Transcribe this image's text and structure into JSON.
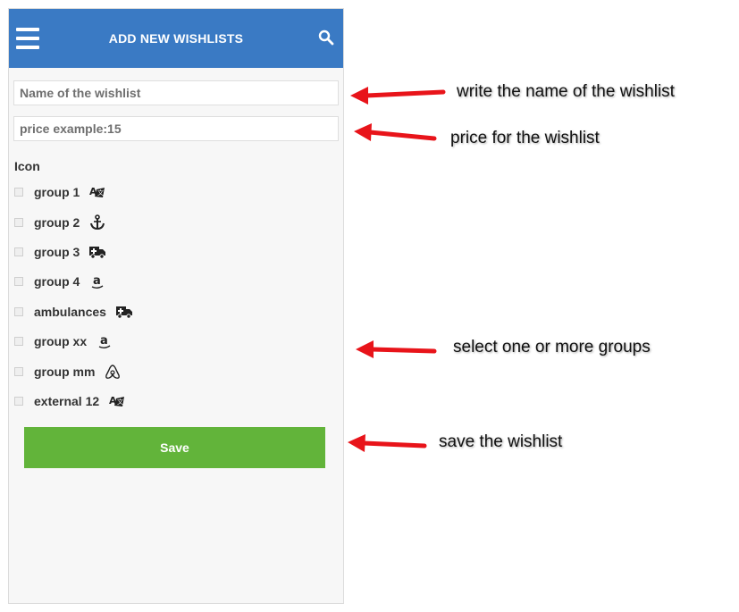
{
  "header": {
    "title": "ADD NEW WISHLISTS",
    "menu_icon": "hamburger-icon",
    "search_icon": "search-icon"
  },
  "form": {
    "name_placeholder": "Name of the wishlist",
    "price_placeholder": "price example:15",
    "icon_label": "Icon",
    "groups": [
      {
        "label": "group 1",
        "icon": "translate-icon"
      },
      {
        "label": "group 2",
        "icon": "anchor-icon"
      },
      {
        "label": "group 3",
        "icon": "ambulance-icon"
      },
      {
        "label": "group 4",
        "icon": "amazon-icon"
      },
      {
        "label": "ambulances",
        "icon": "ambulance-icon"
      },
      {
        "label": "group xx",
        "icon": "amazon-icon"
      },
      {
        "label": "group mm",
        "icon": "airbnb-icon"
      },
      {
        "label": "external 12",
        "icon": "translate-icon"
      }
    ],
    "save_label": "Save"
  },
  "annotations": {
    "name": "write the name of the wishlist",
    "price": "price for the wishlist",
    "groups": "select one or more groups",
    "save": "save the wishlist"
  },
  "colors": {
    "header": "#3a7ac4",
    "save_button": "#62b43a",
    "arrow": "#e8141a"
  }
}
